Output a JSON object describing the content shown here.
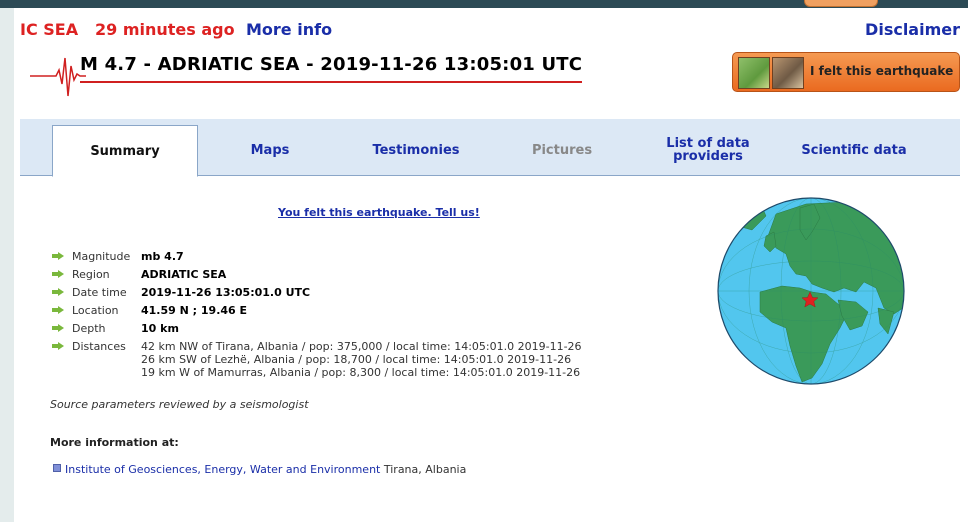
{
  "header": {
    "region_short": "IC SEA",
    "time_ago": "29 minutes ago",
    "more_info": "More info",
    "disclaimer": "Disclaimer"
  },
  "event": {
    "title": "M 4.7 - ADRIATIC SEA - 2019-11-26 13:05:01 UTC"
  },
  "felt_button": {
    "label": "I felt this earthquake"
  },
  "tabs": [
    {
      "label": "Summary",
      "state": "active"
    },
    {
      "label": "Maps",
      "state": "normal"
    },
    {
      "label": "Testimonies",
      "state": "normal"
    },
    {
      "label": "Pictures",
      "state": "disabled"
    },
    {
      "label": "List of data providers",
      "state": "normal"
    },
    {
      "label": "Scientific data",
      "state": "normal"
    }
  ],
  "tell_us": "You felt this earthquake. Tell us!",
  "details": {
    "magnitude": {
      "label": "Magnitude",
      "value": "mb 4.7"
    },
    "region": {
      "label": "Region",
      "value": "ADRIATIC SEA"
    },
    "date_time": {
      "label": "Date time",
      "value": "2019-11-26 13:05:01.0 UTC"
    },
    "location": {
      "label": "Location",
      "value": "41.59 N ; 19.46 E"
    },
    "depth": {
      "label": "Depth",
      "value": "10 km"
    },
    "distances": {
      "label": "Distances",
      "lines": [
        "42 km NW of Tirana, Albania / pop: 375,000 / local time: 14:05:01.0 2019-11-26",
        "26 km SW of Lezhë, Albania / pop: 18,700 / local time: 14:05:01.0 2019-11-26",
        "19 km W of Mamurras, Albania / pop: 8,300 / local time: 14:05:01.0 2019-11-26"
      ]
    }
  },
  "reviewed_note": "Source parameters reviewed by a seismologist",
  "more_information": {
    "heading": "More information at:",
    "link_label": "Institute of Geosciences, Energy, Water and Environment",
    "link_location": "Tirana, Albania"
  },
  "icons": {
    "arrow": "right-arrow-icon",
    "seismogram": "seismogram-icon",
    "globe": "globe-map-icon",
    "epicenter": "star-icon"
  },
  "colors": {
    "accent_red": "#dd2222",
    "link_blue": "#1a2ea8",
    "button_orange": "#ea6a20",
    "tab_bg": "#dce8f5",
    "arrow_green": "#7ab83c",
    "ocean": "#52c6ee",
    "land": "#3a9a5a"
  }
}
